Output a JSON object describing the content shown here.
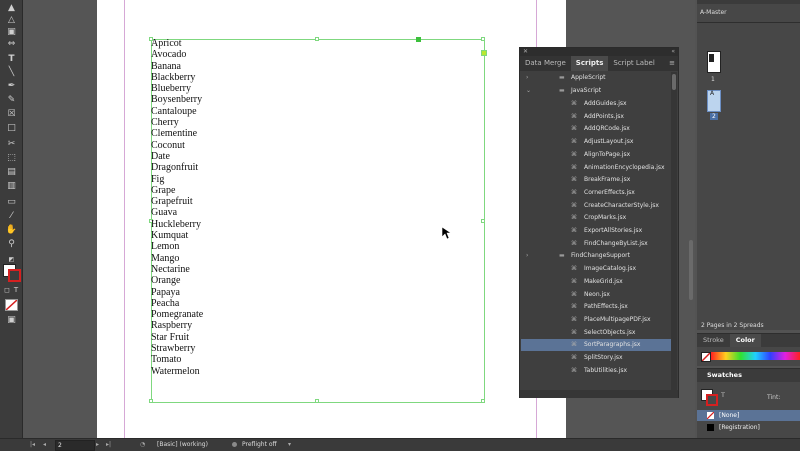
{
  "fruits": [
    "Apricot",
    "Avocado",
    "Banana",
    "Blackberry",
    "Blueberry",
    "Boysenberry",
    "Cantaloupe",
    "Cherry",
    "Clementine",
    "Coconut",
    "Date",
    "Dragonfruit",
    "Fig",
    "Grape",
    "Grapefruit",
    "Guava",
    "Huckleberry",
    "Kumquat",
    "Lemon",
    "Mango",
    "Nectarine",
    "Orange",
    "Papaya",
    "Peacha",
    "Pomegranate",
    "Raspberry",
    "Star Fruit",
    "Strawberry",
    "Tomato",
    "Watermelon"
  ],
  "scripts_panel": {
    "tabs": [
      "Data Merge",
      "Scripts",
      "Script Label"
    ],
    "folders": [
      "AppleScript",
      "JavaScript"
    ],
    "items": [
      "AddGuides.jsx",
      "AddPoints.jsx",
      "AddQRCode.jsx",
      "AdjustLayout.jsx",
      "AlignToPage.jsx",
      "AnimationEncyclopedia.jsx",
      "BreakFrame.jsx",
      "CornerEffects.jsx",
      "CreateCharacterStyle.jsx",
      "CropMarks.jsx",
      "ExportAllStories.jsx",
      "FindChangeByList.jsx",
      "FindChangeSupport",
      "ImageCatalog.jsx",
      "MakeGrid.jsx",
      "Neon.jsx",
      "PathEffects.jsx",
      "PlaceMultipagePDF.jsx",
      "SelectObjects.jsx",
      "SortParagraphs.jsx",
      "SplitStory.jsx",
      "TabUtilities.jsx"
    ],
    "selected": "SortParagraphs.jsx",
    "subfolder": "FindChangeSupport"
  },
  "pages_panel": {
    "master": "A-Master",
    "page1": "1",
    "page2": "2",
    "page2_prefix": "A",
    "summary": "2 Pages in 2 Spreads"
  },
  "color_panel": {
    "tabs": [
      "Stroke",
      "Color"
    ]
  },
  "swatches_panel": {
    "title": "Swatches",
    "tint_label": "Tint:",
    "swatches": [
      "[None]",
      "[Registration]"
    ]
  },
  "status": {
    "page_number": "2",
    "style": "[Basic] (working)",
    "preflight": "Preflight off"
  },
  "tools_text": {
    "type_tool": "T",
    "formatting_t": "T"
  }
}
